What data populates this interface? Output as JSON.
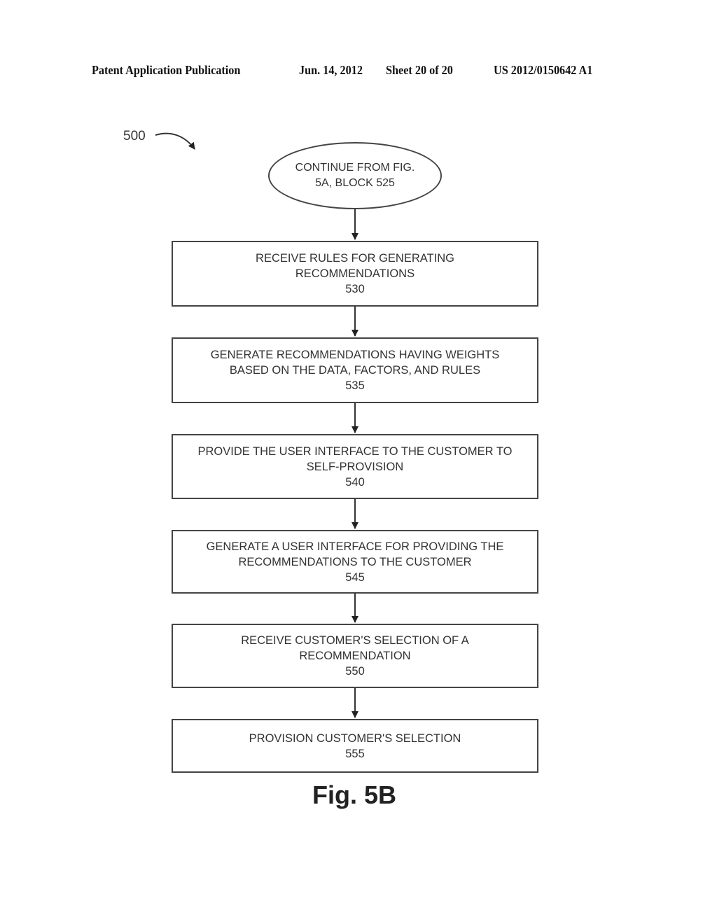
{
  "header": {
    "publication": "Patent Application Publication",
    "date": "Jun. 14, 2012",
    "sheet": "Sheet 20 of 20",
    "number": "US 2012/0150642 A1"
  },
  "diagram": {
    "reference_label": "500",
    "start": {
      "line1": "CONTINUE FROM FIG.",
      "line2": "5A, BLOCK 525"
    },
    "steps": [
      {
        "line1": "RECEIVE RULES FOR GENERATING",
        "line2": "RECOMMENDATIONS",
        "number": "530"
      },
      {
        "line1": "GENERATE RECOMMENDATIONS HAVING WEIGHTS",
        "line2": "BASED ON THE DATA, FACTORS, AND RULES",
        "number": "535"
      },
      {
        "line1": "PROVIDE THE USER INTERFACE TO THE CUSTOMER TO",
        "line2": "SELF-PROVISION",
        "number": "540"
      },
      {
        "line1": "GENERATE A USER INTERFACE FOR PROVIDING THE",
        "line2": "RECOMMENDATIONS TO THE CUSTOMER",
        "number": "545"
      },
      {
        "line1": "RECEIVE CUSTOMER'S SELECTION OF A",
        "line2": "RECOMMENDATION",
        "number": "550"
      },
      {
        "line1": "PROVISION CUSTOMER'S SELECTION",
        "line2": "",
        "number": "555"
      }
    ],
    "figure_label": "Fig. 5B"
  }
}
